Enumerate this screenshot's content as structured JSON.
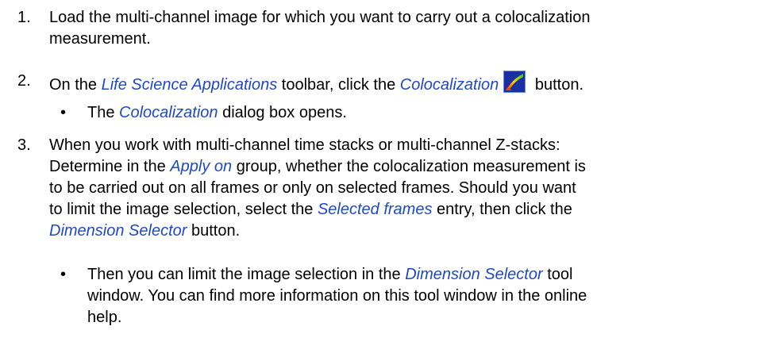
{
  "steps": [
    {
      "number": "1.",
      "lines": [
        "Load the multi-channel image for which you want to carry out a colocalization",
        "measurement."
      ]
    },
    {
      "number": "2.",
      "line_parts": {
        "a": "On the ",
        "b": "Life Science Applications",
        "c": " toolbar, click the ",
        "d": "Colocalization",
        "e": " button."
      },
      "bullet": {
        "a": "The ",
        "b": "Colocalization",
        "c": " dialog box opens."
      }
    },
    {
      "number": "3.",
      "l1": "When you work with multi-channel time stacks or multi-channel Z-stacks:",
      "l2a": "Determine in the ",
      "l2b": "Apply on",
      "l2c": " group, whether the colocalization measurement is",
      "l3": "to be carried out on all frames or only on selected frames. Should you want",
      "l4a": "to limit the image selection, select the ",
      "l4b": "Selected frames",
      "l4c": " entry, then click the",
      "l5a": "Dimension Selector",
      "l5b": " button.",
      "bullet": {
        "l1a": "Then you can limit the image selection in the ",
        "l1b": "Dimension Selector",
        "l1c": " tool",
        "l2": "window. You can find more information on this tool window in the online",
        "l3": "help."
      }
    }
  ],
  "bullet_symbol": "•",
  "icon": "colocalization-icon"
}
